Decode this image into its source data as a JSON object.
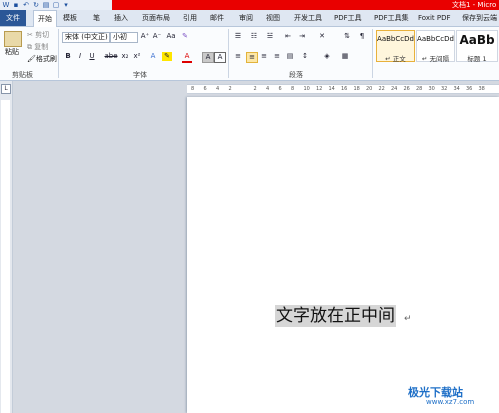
{
  "title_bar": {
    "title": "文档1 - Micro"
  },
  "tabs": [
    "文件",
    "开始",
    "模板",
    "笔",
    "插入",
    "页面布局",
    "引用",
    "邮件",
    "审阅",
    "视图",
    "开发工具",
    "PDF工具",
    "PDF工具集",
    "Foxit PDF",
    "保存到云端"
  ],
  "clipboard": {
    "paste": "粘贴",
    "cut": "剪切",
    "copy": "复制",
    "format_painter": "格式刷",
    "label": "剪贴板"
  },
  "font": {
    "name": "宋体 (中文正)",
    "size": "小初",
    "label": "字体",
    "bold": "B",
    "italic": "I",
    "underline": "U",
    "strike": "abe",
    "sub": "x₂",
    "sup": "x²",
    "grow": "A⁺",
    "shrink": "A⁻",
    "aa": "Aa",
    "font_color": "A"
  },
  "paragraph": {
    "label": "段落"
  },
  "styles": [
    {
      "sample": "AaBbCcDd",
      "name": "↵ 正文"
    },
    {
      "sample": "AaBbCcDd",
      "name": "↵ 无间隔"
    },
    {
      "sample": "AaBb",
      "name": "标题 1"
    }
  ],
  "ruler": {
    "corner": "L",
    "ticks": [
      "8",
      "6",
      "4",
      "2",
      "",
      "2",
      "4",
      "6",
      "8",
      "10",
      "12",
      "14",
      "16",
      "18",
      "20",
      "22",
      "24",
      "26",
      "28",
      "30",
      "32",
      "34",
      "36",
      "38"
    ]
  },
  "document": {
    "text": "文字放在正中间",
    "para_mark": "↵"
  },
  "watermark": {
    "name": "极光下载站",
    "url": "www.xz7.com"
  }
}
